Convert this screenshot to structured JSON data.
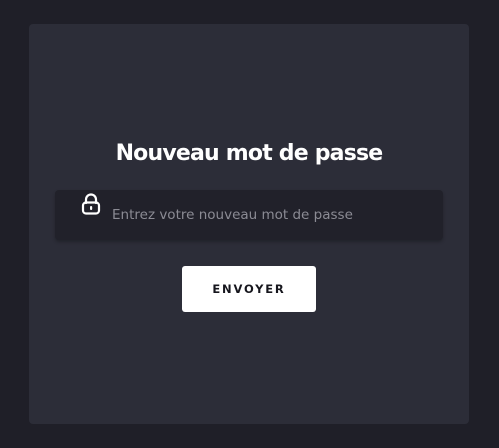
{
  "form": {
    "title": "Nouveau mot de passe",
    "password": {
      "value": "",
      "placeholder": "Entrez votre nouveau mot de passe",
      "icon": "lock-icon"
    },
    "submit_label": "ENVOYER"
  },
  "colors": {
    "background": "#1f1f28",
    "card": "#2c2d38",
    "input_background": "#21212a",
    "placeholder": "#8b8b94",
    "button_background": "#ffffff",
    "button_text": "#16161d",
    "title": "#ffffff"
  }
}
